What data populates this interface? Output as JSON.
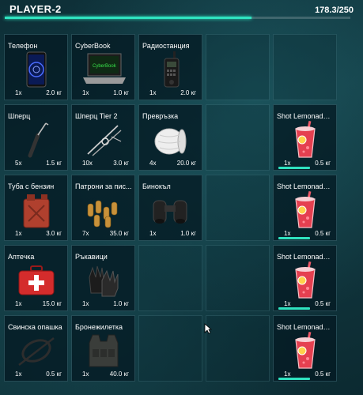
{
  "player": {
    "name": "PLAYER-2",
    "weight_text": "178.3/250",
    "weight_fraction": 0.713
  },
  "colors": {
    "accent": "#2fe3c0",
    "background": "#123a42"
  },
  "slots": [
    {
      "name": "Телефон",
      "qty": "1x",
      "weight": "2.0 кг",
      "icon": "phone-icon"
    },
    {
      "name": "CyberBook",
      "qty": "1x",
      "weight": "1.0 кг",
      "icon": "laptop-icon"
    },
    {
      "name": "Радиостанция",
      "qty": "1x",
      "weight": "2.0 кг",
      "icon": "radio-icon"
    },
    null,
    null,
    {
      "name": "Шперц",
      "qty": "5x",
      "weight": "1.5 кг",
      "icon": "lockpick-icon"
    },
    {
      "name": "Шперц Tier 2",
      "qty": "10x",
      "weight": "3.0 кг",
      "icon": "lockpick-set-icon"
    },
    {
      "name": "Превръзка",
      "qty": "4x",
      "weight": "20.0 кг",
      "icon": "bandage-icon"
    },
    null,
    {
      "name": "Shot Lemonade ...",
      "qty": "1x",
      "weight": "0.5 кг",
      "icon": "lemonade-icon",
      "durability": 1
    },
    {
      "name": "Туба с бензин",
      "qty": "1x",
      "weight": "3.0 кг",
      "icon": "gas-can-icon"
    },
    {
      "name": "Патрони за пис...",
      "qty": "7x",
      "weight": "35.0 кг",
      "icon": "ammo-icon"
    },
    {
      "name": "Бинокъл",
      "qty": "1x",
      "weight": "1.0 кг",
      "icon": "binoculars-icon"
    },
    null,
    {
      "name": "Shot Lemonade ...",
      "qty": "1x",
      "weight": "0.5 кг",
      "icon": "lemonade-icon",
      "durability": 1
    },
    {
      "name": "Аптечка",
      "qty": "1x",
      "weight": "15.0 кг",
      "icon": "medkit-icon"
    },
    {
      "name": "Ръкавици",
      "qty": "1x",
      "weight": "1.0 кг",
      "icon": "gloves-icon"
    },
    null,
    null,
    {
      "name": "Shot Lemonade ...",
      "qty": "1x",
      "weight": "0.5 кг",
      "icon": "lemonade-icon",
      "durability": 1
    },
    {
      "name": "Свинска опашка",
      "qty": "1x",
      "weight": "0.5 кг",
      "icon": "zip-tie-icon"
    },
    {
      "name": "Бронежилетка",
      "qty": "1x",
      "weight": "40.0 кг",
      "icon": "vest-icon"
    },
    null,
    null,
    {
      "name": "Shot Lemonade ...",
      "qty": "1x",
      "weight": "0.5 кг",
      "icon": "lemonade-icon",
      "durability": 1
    }
  ]
}
